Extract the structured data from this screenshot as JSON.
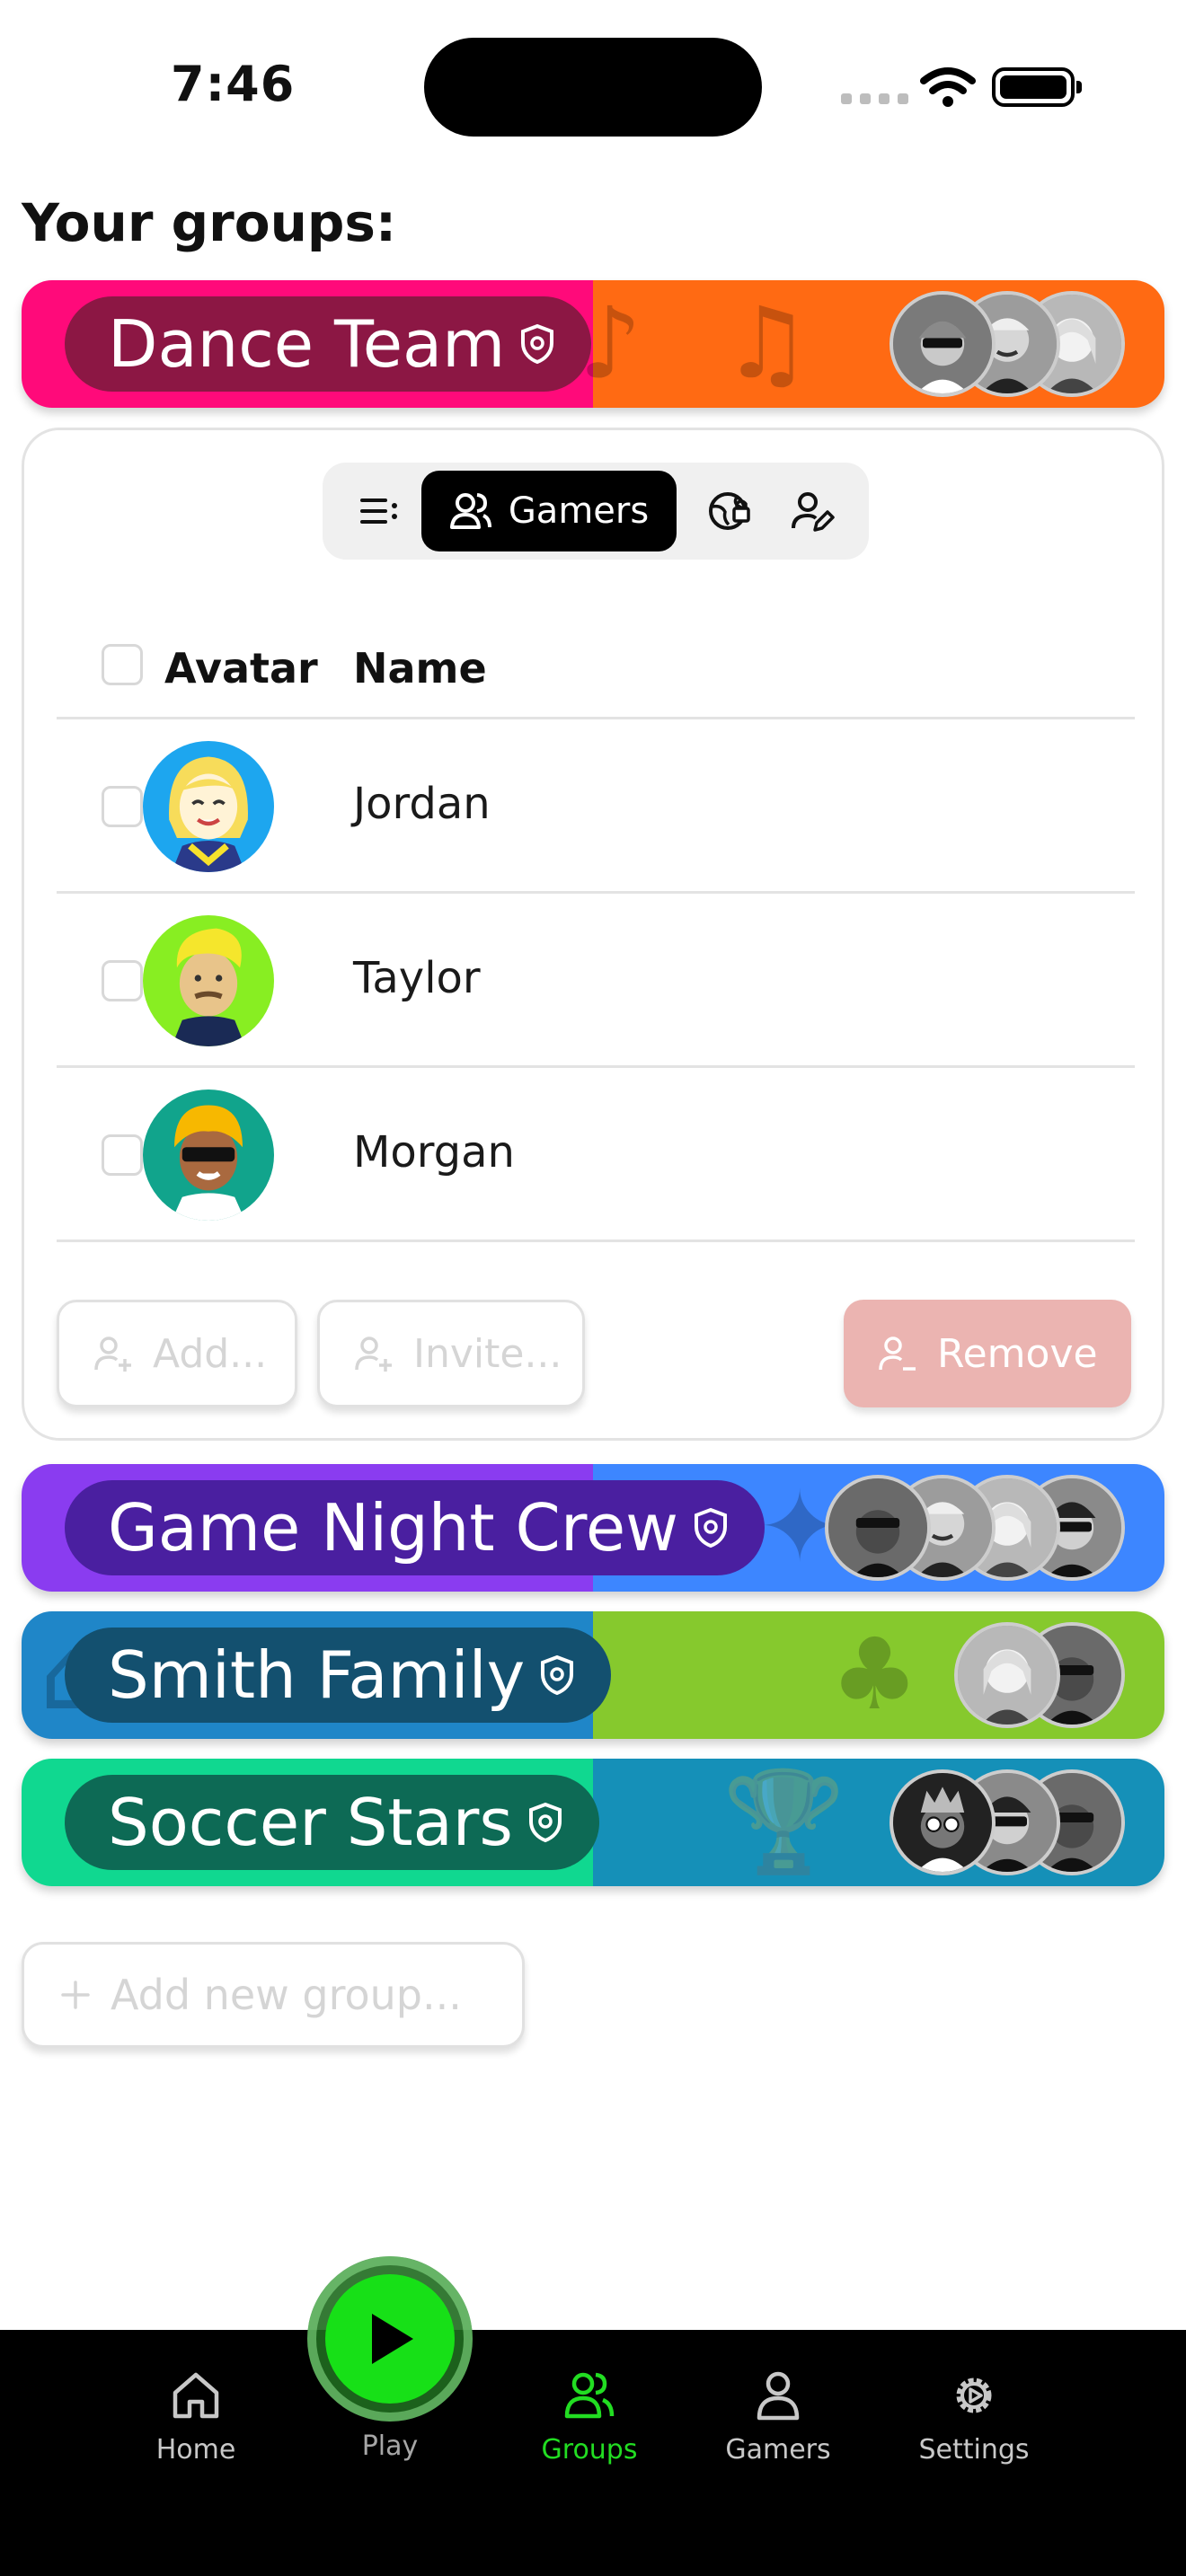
{
  "status": {
    "time": "7:46"
  },
  "title": "Your groups:",
  "groups": [
    {
      "name": "Dance Team",
      "left_color": "#ff0a7a",
      "right_color": "#ff6a13",
      "pill_color": "#8c1744",
      "deco_left": "♪",
      "deco_right": "♫"
    },
    {
      "name": "Game Night Crew",
      "left_color": "#8a3cf0",
      "right_color": "#3d86ff",
      "pill_color": "#4a1fa0",
      "deco_left": "✦",
      "deco_right": "✦"
    },
    {
      "name": "Smith Family",
      "left_color": "#1f86c8",
      "right_color": "#86c92d",
      "pill_color": "#13506f",
      "deco_left": "⌂",
      "deco_right": "♣"
    },
    {
      "name": "Soccer Stars",
      "left_color": "#10d890",
      "right_color": "#1590b8",
      "pill_color": "#0d6a55",
      "deco_left": "⚽",
      "deco_right": "🏆"
    }
  ],
  "card": {
    "segment_active": "Gamers",
    "columns": [
      "Avatar",
      "Name"
    ],
    "rows": [
      {
        "name": "Jordan",
        "bg": "#1da6ef",
        "hair": "#f7dc5a",
        "skin": "#fff3d6"
      },
      {
        "name": "Taylor",
        "bg": "#88ee22",
        "hair": "#f5e62c",
        "skin": "#e8c48a"
      },
      {
        "name": "Morgan",
        "bg": "#11a48c",
        "hair": "#f7b800",
        "skin": "#a9693f"
      }
    ],
    "add_label": "Add...",
    "invite_label": "Invite...",
    "remove_label": "Remove"
  },
  "add_group_label": "Add new group...",
  "tabs": {
    "home": "Home",
    "play": "Play",
    "groups": "Groups",
    "gamers": "Gamers",
    "settings": "Settings"
  },
  "colors": {
    "accent_green": "#22dd22",
    "remove_pink": "#ebb4b1"
  }
}
